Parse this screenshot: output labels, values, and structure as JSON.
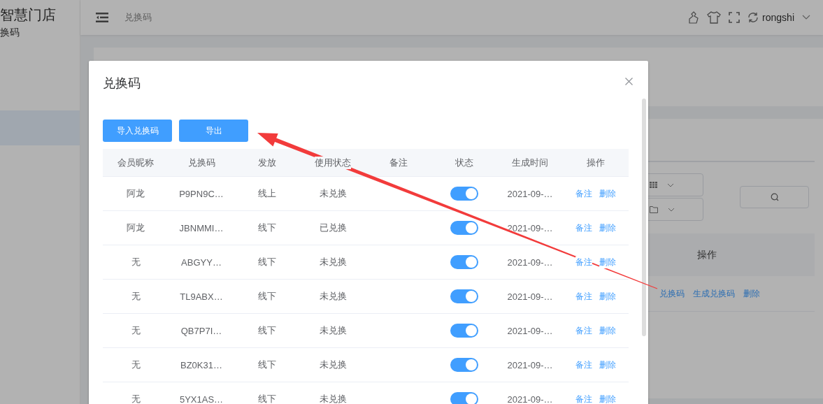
{
  "sidebar": {
    "title": "智慧门店",
    "subtitle": "换码"
  },
  "header": {
    "breadcrumb": "兑换码",
    "user": "rongshi"
  },
  "page_table": {
    "column": "操作",
    "actions": [
      "兑换码",
      "生成兑换码",
      "删除"
    ]
  },
  "dialog": {
    "title": "兑换码",
    "buttons": [
      "导入兑换码",
      "导出"
    ],
    "table": {
      "columns": [
        "会员昵称",
        "兑换码",
        "发放",
        "使用状态",
        "备注",
        "状态",
        "生成时间",
        "操作"
      ],
      "rows": [
        {
          "member": "阿龙",
          "code": "P9PN9C…",
          "issue": "线上",
          "usage": "未兑换",
          "on": true,
          "created": "2021-09-…",
          "actions": [
            "备注",
            "删除"
          ]
        },
        {
          "member": "阿龙",
          "code": "JBNMMI…",
          "issue": "线下",
          "usage": "已兑换",
          "on": true,
          "created": "2021-09-…",
          "actions": [
            "备注",
            "删除"
          ]
        },
        {
          "member": "无",
          "code": "ABGYY…",
          "issue": "线下",
          "usage": "未兑换",
          "on": true,
          "created": "2021-09-…",
          "actions": [
            "备注",
            "删除"
          ]
        },
        {
          "member": "无",
          "code": "TL9ABX…",
          "issue": "线下",
          "usage": "未兑换",
          "on": true,
          "created": "2021-09-…",
          "actions": [
            "备注",
            "删除"
          ]
        },
        {
          "member": "无",
          "code": "QB7P7I…",
          "issue": "线下",
          "usage": "未兑换",
          "on": true,
          "created": "2021-09-…",
          "actions": [
            "备注",
            "删除"
          ]
        },
        {
          "member": "无",
          "code": "BZ0K31…",
          "issue": "线下",
          "usage": "未兑换",
          "on": true,
          "created": "2021-09-…",
          "actions": [
            "备注",
            "删除"
          ]
        },
        {
          "member": "无",
          "code": "5YX1AS…",
          "issue": "线下",
          "usage": "未兑换",
          "on": true,
          "created": "2021-09-…",
          "actions": [
            "备注",
            "删除"
          ]
        }
      ]
    }
  }
}
